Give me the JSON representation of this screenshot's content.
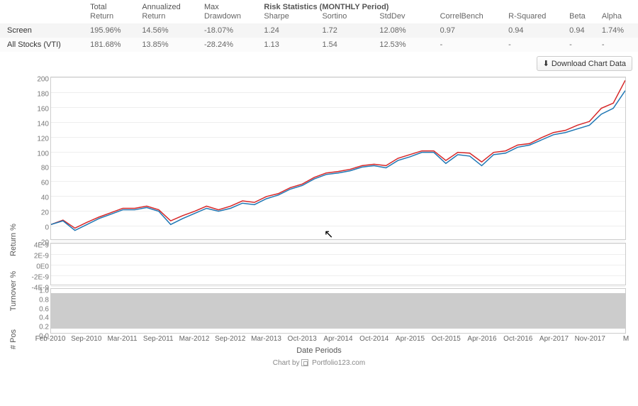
{
  "table": {
    "section_header": "Risk Statistics (MONTHLY Period)",
    "headers_row1": [
      "",
      "Total",
      "Annualized",
      "Max",
      "",
      "",
      "",
      "",
      "",
      "",
      ""
    ],
    "headers_row2": [
      "",
      "Return",
      "Return",
      "Drawdown",
      "Sharpe",
      "Sortino",
      "StdDev",
      "CorrelBench",
      "R-Squared",
      "Beta",
      "Alpha"
    ],
    "rows": [
      {
        "name": "Screen",
        "total": "195.96%",
        "ann": "14.56%",
        "dd": "-18.07%",
        "dd_neg": true,
        "sharpe": "1.24",
        "sortino": "1.72",
        "stddev": "12.08%",
        "corr": "0.97",
        "r2": "0.94",
        "beta": "0.94",
        "alpha": "1.74%"
      },
      {
        "name": "All Stocks (VTI)",
        "total": "181.68%",
        "ann": "13.85%",
        "dd": "-28.24%",
        "dd_neg": true,
        "sharpe": "1.13",
        "sortino": "1.54",
        "stddev": "12.53%",
        "corr": "-",
        "r2": "-",
        "beta": "-",
        "alpha": "-"
      }
    ]
  },
  "download_label": "Download Chart Data",
  "xlabel": "Date Periods",
  "attribution_prefix": "Chart by",
  "attribution_brand": "Portfolio123.com",
  "panels": {
    "return": {
      "label": "Return %",
      "ymin": -20,
      "ymax": 200,
      "yticks": [
        -20,
        0,
        20,
        40,
        60,
        80,
        100,
        120,
        140,
        160,
        180,
        200
      ]
    },
    "turnover": {
      "label": "Turnover %",
      "yticks_labels": [
        "4E-9",
        "2E-9",
        "0E0",
        "-2E-9",
        "-4E-9"
      ]
    },
    "pos": {
      "label": "# Pos",
      "yticks_labels": [
        "1.0",
        "0.8",
        "0.6",
        "0.4",
        "0.2",
        "0.0"
      ]
    }
  },
  "x_categories": [
    "Feb-2010",
    "Sep-2010",
    "Mar-2011",
    "Sep-2011",
    "Mar-2012",
    "Sep-2012",
    "Mar-2013",
    "Oct-2013",
    "Apr-2014",
    "Oct-2014",
    "Apr-2015",
    "Oct-2015",
    "Apr-2016",
    "Oct-2016",
    "Apr-2017",
    "Nov-2017",
    "M"
  ],
  "chart_data": {
    "type": "line",
    "title": "",
    "xlabel": "Date Periods",
    "ylabel": "Return %",
    "ylim": [
      -20,
      200
    ],
    "x": [
      "Feb-2010",
      "Apr-2010",
      "May-2010",
      "Jun-2010",
      "Sep-2010",
      "Nov-2010",
      "Jan-2011",
      "Mar-2011",
      "May-2011",
      "Jul-2011",
      "Sep-2011",
      "Nov-2011",
      "Jan-2012",
      "Mar-2012",
      "May-2012",
      "Jul-2012",
      "Sep-2012",
      "Nov-2012",
      "Jan-2013",
      "Mar-2013",
      "May-2013",
      "Jul-2013",
      "Oct-2013",
      "Dec-2013",
      "Feb-2014",
      "Apr-2014",
      "Jun-2014",
      "Aug-2014",
      "Oct-2014",
      "Dec-2014",
      "Feb-2015",
      "Apr-2015",
      "Jun-2015",
      "Aug-2015",
      "Oct-2015",
      "Dec-2015",
      "Feb-2016",
      "Apr-2016",
      "Jun-2016",
      "Aug-2016",
      "Oct-2016",
      "Dec-2016",
      "Feb-2017",
      "Apr-2017",
      "Jun-2017",
      "Aug-2017",
      "Oct-2017",
      "Nov-2017",
      "Jan-2018"
    ],
    "series": [
      {
        "name": "Screen",
        "color": "#d62728",
        "values": [
          0,
          6,
          -5,
          3,
          10,
          16,
          22,
          22,
          25,
          20,
          5,
          12,
          18,
          25,
          20,
          25,
          32,
          30,
          38,
          42,
          50,
          55,
          64,
          70,
          72,
          75,
          80,
          82,
          80,
          90,
          95,
          100,
          100,
          87,
          98,
          97,
          85,
          98,
          100,
          108,
          110,
          118,
          125,
          128,
          135,
          140,
          158,
          165,
          196
        ]
      },
      {
        "name": "All Stocks (VTI)",
        "color": "#1f77b4",
        "values": [
          0,
          5,
          -8,
          0,
          8,
          14,
          20,
          20,
          23,
          18,
          0,
          8,
          15,
          22,
          18,
          22,
          29,
          27,
          35,
          40,
          48,
          53,
          62,
          68,
          70,
          73,
          78,
          80,
          77,
          87,
          92,
          98,
          98,
          83,
          95,
          93,
          80,
          95,
          97,
          105,
          108,
          115,
          122,
          125,
          130,
          135,
          150,
          158,
          182
        ]
      }
    ],
    "secondary_panels": [
      {
        "name": "Turnover %",
        "type": "line",
        "values_constant": 0,
        "ylim": [
          -4e-09,
          4e-09
        ]
      },
      {
        "name": "# Pos",
        "type": "area",
        "values_constant": 1.0,
        "ylim": [
          0,
          1.0
        ]
      }
    ]
  }
}
